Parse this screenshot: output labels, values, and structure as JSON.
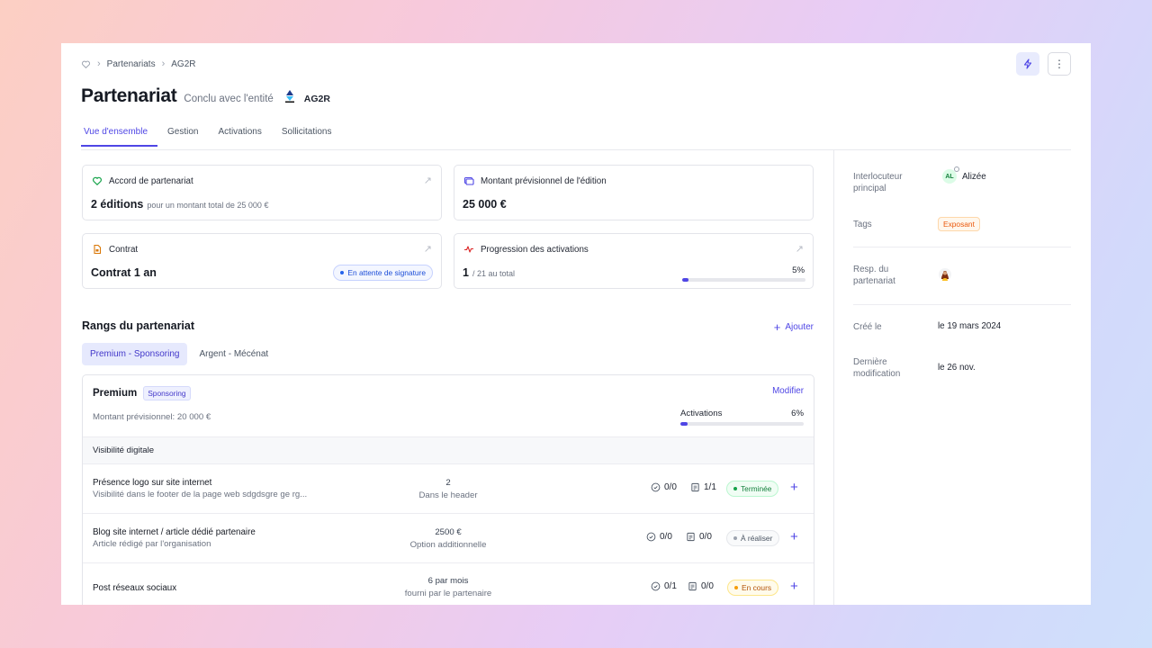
{
  "breadcrumb": {
    "home_icon": "heart-hand-icon",
    "items": [
      "Partenariats",
      "AG2R"
    ]
  },
  "header": {
    "title": "Partenariat",
    "subtitle": "Conclu avec l'entité",
    "entity": "AG2R"
  },
  "toolbar": {
    "lightning_icon": "lightning-icon",
    "more_icon": "more-vertical-icon"
  },
  "tabs": [
    {
      "label": "Vue d'ensemble",
      "active": true
    },
    {
      "label": "Gestion",
      "active": false
    },
    {
      "label": "Activations",
      "active": false
    },
    {
      "label": "Sollicitations",
      "active": false
    }
  ],
  "cards": {
    "accord": {
      "title": "Accord de partenariat",
      "value": "2 éditions",
      "detail": "pour un montant total de 25 000 €"
    },
    "montant": {
      "title": "Montant prévisionnel de l'édition",
      "value": "25 000 €"
    },
    "contrat": {
      "title": "Contrat",
      "value": "Contrat 1 an",
      "badge": "En attente de signature"
    },
    "progression": {
      "title": "Progression des activations",
      "value": "1",
      "detail": "/ 21 au total",
      "percent": "5%",
      "fraction": 0.05
    }
  },
  "ranks": {
    "title": "Rangs du partenariat",
    "add_label": "Ajouter",
    "tabs": [
      {
        "label": "Premium - Sponsoring",
        "active": true
      },
      {
        "label": "Argent - Mécénat",
        "active": false
      }
    ],
    "current": {
      "name": "Premium",
      "tag": "Sponsoring",
      "edit_label": "Modifier",
      "amount": "Montant prévisionnel: 20 000 €",
      "activations_label": "Activations",
      "activations_percent": "6%",
      "activations_fraction": 0.06,
      "group": "Visibilité digitale",
      "items": [
        {
          "name": "Présence logo sur site internet",
          "desc": "Visibilité dans le footer de la page web sdgdsgre ge rg...",
          "qty": "2",
          "qty_note": "Dans le header",
          "checks": "0/0",
          "docs": "1/1",
          "status": "Terminée"
        },
        {
          "name": "Blog site internet / article dédié partenaire",
          "desc": "Article rédigé par l'organisation",
          "qty": "2500 €",
          "qty_note": "Option additionnelle",
          "checks": "0/0",
          "docs": "0/0",
          "status": "À réaliser"
        },
        {
          "name": "Post réseaux sociaux",
          "desc": "",
          "qty": "6 par mois",
          "qty_note": "fourni par le partenaire",
          "checks": "0/1",
          "docs": "0/0",
          "status": "En cours"
        }
      ]
    }
  },
  "sidebar": {
    "interlocuteur_label": "Interlocuteur principal",
    "interlocuteur_initials": "AL",
    "interlocuteur_name": "Alizée",
    "tags_label": "Tags",
    "tag": "Exposant",
    "resp_label": "Resp. du partenariat",
    "created_label": "Créé le",
    "created_value": "le 19 mars 2024",
    "modified_label": "Dernière modification",
    "modified_value": "le 26 nov."
  },
  "colors": {
    "accent": "#4f46e5",
    "green": "#16a34a",
    "orange": "#ea580c",
    "blue": "#2563eb",
    "amber": "#d97706"
  }
}
